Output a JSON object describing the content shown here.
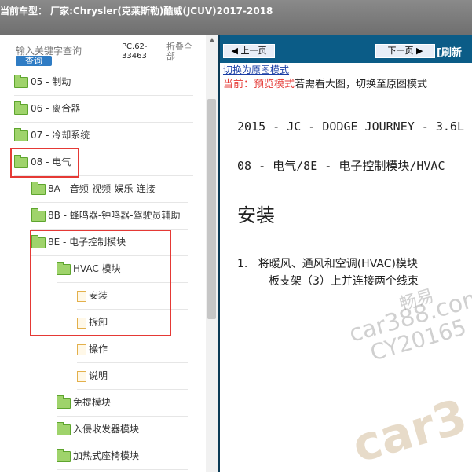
{
  "header": {
    "title": "当前车型：  厂家:Chrysler(克莱斯勒)酷威(JCUV)2017-2018"
  },
  "left": {
    "search_placeholder": "输入关键字查询",
    "search_button": "查询",
    "code": "PC.62-33463",
    "collapse_all": "折叠全部"
  },
  "tree": [
    {
      "label": "05 - 制动",
      "icon": "folder-icon"
    },
    {
      "label": "06 - 离合器",
      "icon": "folder-icon"
    },
    {
      "label": "07 - 冷却系统",
      "icon": "folder-icon"
    },
    {
      "label": "08 - 电气",
      "icon": "folder-open-icon"
    },
    {
      "label": "8A - 音频-视频-娱乐-连接",
      "icon": "folder-icon"
    },
    {
      "label": "8B - 蜂鸣器-钟鸣器-驾驶员辅助",
      "icon": "folder-icon"
    },
    {
      "label": "8E - 电子控制模块",
      "icon": "folder-open-icon"
    },
    {
      "label": "HVAC 模块",
      "icon": "folder-open-icon"
    },
    {
      "label": "安装",
      "icon": "document-icon"
    },
    {
      "label": "拆卸",
      "icon": "document-icon"
    },
    {
      "label": "操作",
      "icon": "document-icon"
    },
    {
      "label": "说明",
      "icon": "document-icon"
    },
    {
      "label": "免提模块",
      "icon": "folder-icon"
    },
    {
      "label": "入侵收发器模块",
      "icon": "folder-icon"
    },
    {
      "label": "加热式座椅模块",
      "icon": "folder-icon"
    }
  ],
  "right": {
    "prev": "上一页",
    "next": "下一页",
    "refresh": "[刷新",
    "switch_link": "切换为原图模式",
    "mode_current": "当前：预览模式",
    "mode_rest": "若需看大图，切换至原图模式",
    "doc_line1": "2015 - JC - DODGE JOURNEY - 3.6L",
    "doc_line2": "08 - 电气/8E - 电子控制模块/HVAC",
    "doc_heading": "安装",
    "doc_step_num": "1.",
    "doc_step_text1": "将暖风、通风和空调(HVAC)模块",
    "doc_step_text2": "板支架（3）上并连接两个线束"
  },
  "watermark": {
    "line1": "畅易",
    "line2": "car388.com",
    "line3": "CY20165",
    "logo": "car3"
  },
  "colors": {
    "header": "#7a7a7a",
    "nav": "#0b5c87",
    "highlight": "#e53935",
    "search_button": "#2f7cc4"
  }
}
